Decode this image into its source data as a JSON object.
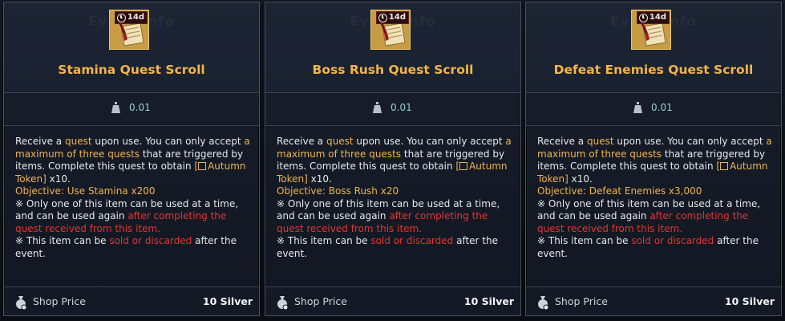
{
  "ghost_header": "Event Info",
  "badge": {
    "label": "14d"
  },
  "item_description": {
    "line1_pre": "Receive a ",
    "line1_quest": "quest",
    "line1_post": " upon use. You can only accept",
    "max_quests": "a maximum of three quests",
    "line2_post": " that are triggered by items. Complete this quest to obtain",
    "token_label": "Autumn Token]",
    "token_bracket": "[",
    "token_qty": " x10."
  },
  "notes": {
    "note1_pre": "※ Only one of this item can be used at a time, and can be used again ",
    "note1_red": "after completing the quest received from this item.",
    "note2_pre": "※ This item can be ",
    "note2_red": "sold or discarded",
    "note2_post": " after the event."
  },
  "footer": {
    "shop_label": "Shop Price",
    "price": "10 Silver"
  },
  "tooltips": [
    {
      "title": "Stamina Quest Scroll",
      "weight": "0.01",
      "objective": "Objective: Use Stamina x200"
    },
    {
      "title": "Boss Rush Quest Scroll",
      "weight": "0.01",
      "objective": "Objective: Boss Rush x20"
    },
    {
      "title": "Defeat Enemies Quest Scroll",
      "weight": "0.01",
      "objective": "Objective: Defeat Enemies x3,000"
    }
  ],
  "colors": {
    "title_gold": "#f0b44b",
    "highlight_red": "#e8322f",
    "weight_teal": "#8fd6cf"
  },
  "icons": {
    "item": "quest-scroll-icon",
    "timer": "clock-icon",
    "weight": "weight-icon",
    "price": "money-bag-icon",
    "link": "external-link-icon"
  }
}
